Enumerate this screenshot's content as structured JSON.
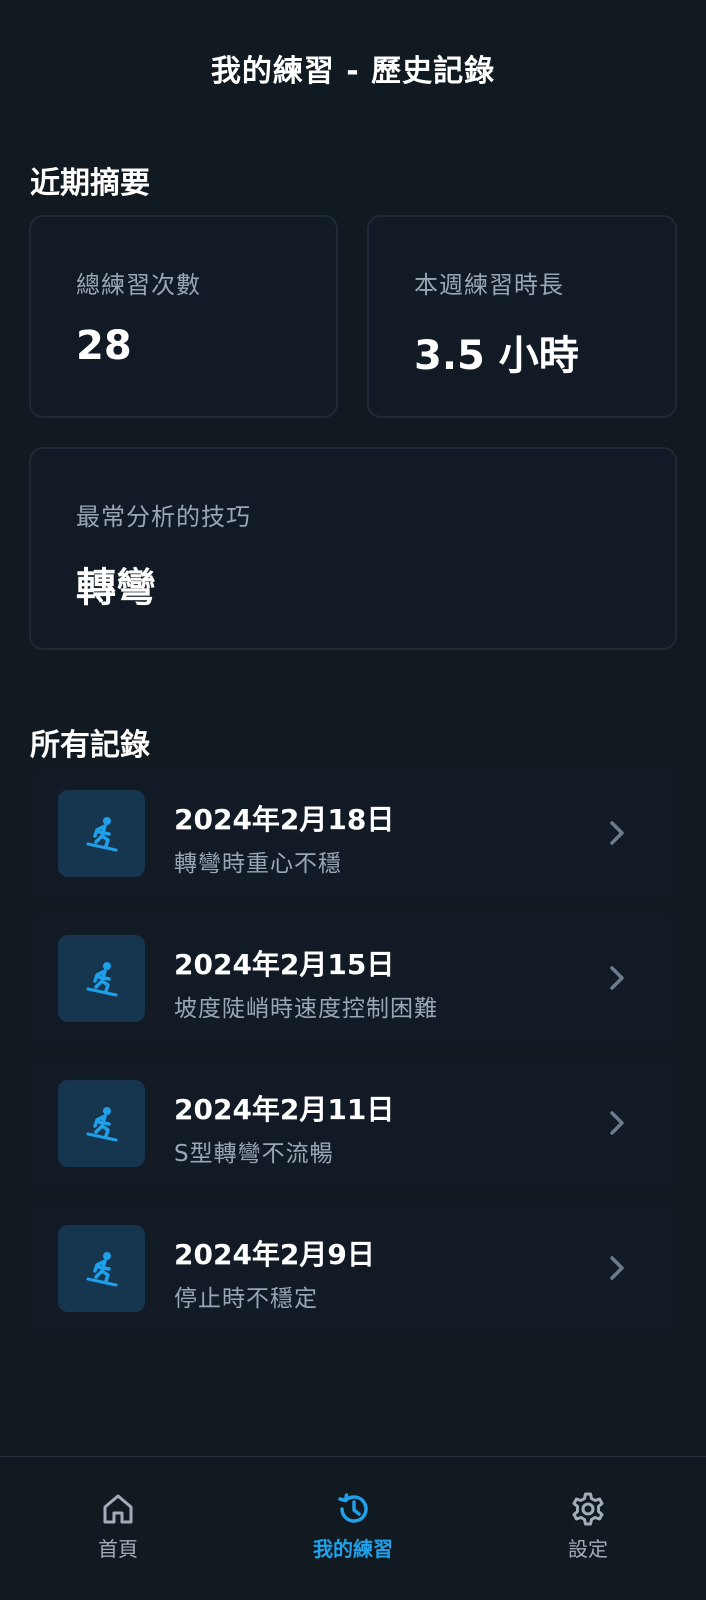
{
  "header": {
    "title": "我的練習 - 歷史記錄"
  },
  "summary": {
    "title": "近期摘要",
    "total_sessions": {
      "label": "總練習次數",
      "value": "28"
    },
    "weekly_duration": {
      "label": "本週練習時長",
      "value": "3.5 小時"
    },
    "top_skill": {
      "label": "最常分析的技巧",
      "value": "轉彎"
    }
  },
  "records": {
    "title": "所有記錄",
    "items": [
      {
        "date": "2024年2月18日",
        "description": "轉彎時重心不穩",
        "icon": "snowboarder-icon"
      },
      {
        "date": "2024年2月15日",
        "description": "坡度陡峭時速度控制困難",
        "icon": "snowboarder-icon"
      },
      {
        "date": "2024年2月11日",
        "description": "S型轉彎不流暢",
        "icon": "snowboarder-icon"
      },
      {
        "date": "2024年2月9日",
        "description": "停止時不穩定",
        "icon": "snowboarder-icon"
      }
    ]
  },
  "nav": {
    "items": [
      {
        "label": "首頁",
        "icon": "home-icon",
        "active": false
      },
      {
        "label": "我的練習",
        "icon": "history-icon",
        "active": true
      },
      {
        "label": "設定",
        "icon": "gear-icon",
        "active": false
      }
    ]
  },
  "colors": {
    "background": "#121A21",
    "card": "#111A25",
    "accent": "#1FA0E8",
    "thumb": "#163650",
    "muted_text": "#9AA6B6"
  }
}
